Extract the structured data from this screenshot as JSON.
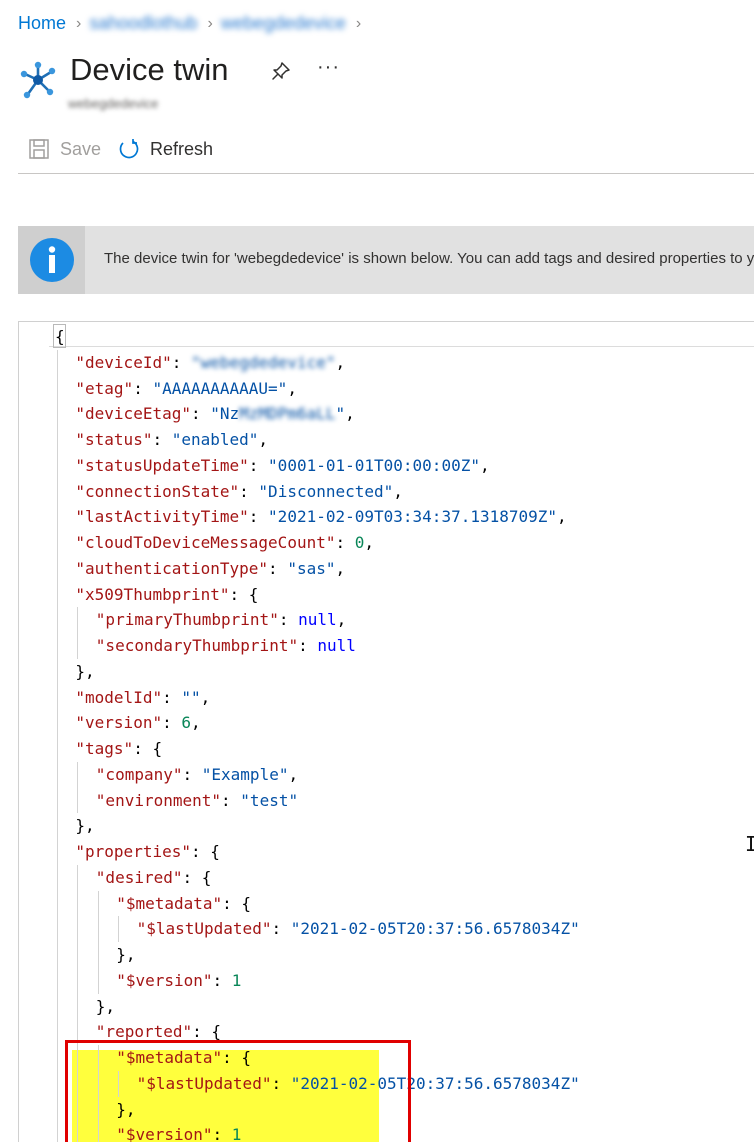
{
  "breadcrumb": {
    "home": "Home",
    "hub": "sahoodlothub",
    "device": "webegdedevice"
  },
  "header": {
    "title": "Device twin",
    "subtitle": "webegdedevice",
    "icons": {
      "service": "iot-hub-icon",
      "pin": "pin-icon",
      "more": "more-icon"
    },
    "more_label": "···"
  },
  "toolbar": {
    "save_label": "Save",
    "refresh_label": "Refresh"
  },
  "info_banner": {
    "text": "The device twin for 'webegdedevice' is shown below. You can add tags and desired properties to your device twin here."
  },
  "editor": {
    "lines": [
      [
        [
          "p",
          "{"
        ]
      ],
      [
        [
          "k",
          "\"deviceId\""
        ],
        [
          "p",
          ": "
        ],
        [
          "x",
          "\"webegdedevice\""
        ],
        [
          "p",
          ","
        ]
      ],
      [
        [
          "k",
          "\"etag\""
        ],
        [
          "p",
          ": "
        ],
        [
          "s",
          "\"AAAAAAAAAAU=\""
        ],
        [
          "p",
          ","
        ]
      ],
      [
        [
          "k",
          "\"deviceEtag\""
        ],
        [
          "p",
          ": "
        ],
        [
          "s",
          "\"Nz"
        ],
        [
          "x",
          "MzMDPm6aLL"
        ],
        [
          "s",
          "\""
        ],
        [
          "p",
          ","
        ]
      ],
      [
        [
          "k",
          "\"status\""
        ],
        [
          "p",
          ": "
        ],
        [
          "s",
          "\"enabled\""
        ],
        [
          "p",
          ","
        ]
      ],
      [
        [
          "k",
          "\"statusUpdateTime\""
        ],
        [
          "p",
          ": "
        ],
        [
          "s",
          "\"0001-01-01T00:00:00Z\""
        ],
        [
          "p",
          ","
        ]
      ],
      [
        [
          "k",
          "\"connectionState\""
        ],
        [
          "p",
          ": "
        ],
        [
          "s",
          "\"Disconnected\""
        ],
        [
          "p",
          ","
        ]
      ],
      [
        [
          "k",
          "\"lastActivityTime\""
        ],
        [
          "p",
          ": "
        ],
        [
          "s",
          "\"2021-02-09T03:34:37.1318709Z\""
        ],
        [
          "p",
          ","
        ]
      ],
      [
        [
          "k",
          "\"cloudToDeviceMessageCount\""
        ],
        [
          "p",
          ": "
        ],
        [
          "n",
          "0"
        ],
        [
          "p",
          ","
        ]
      ],
      [
        [
          "k",
          "\"authenticationType\""
        ],
        [
          "p",
          ": "
        ],
        [
          "s",
          "\"sas\""
        ],
        [
          "p",
          ","
        ]
      ],
      [
        [
          "k",
          "\"x509Thumbprint\""
        ],
        [
          "p",
          ": {"
        ]
      ],
      [
        [
          "k",
          "\"primaryThumbprint\""
        ],
        [
          "p",
          ": "
        ],
        [
          "b",
          "null"
        ],
        [
          "p",
          ","
        ]
      ],
      [
        [
          "k",
          "\"secondaryThumbprint\""
        ],
        [
          "p",
          ": "
        ],
        [
          "b",
          "null"
        ]
      ],
      [
        [
          "p",
          "},"
        ]
      ],
      [
        [
          "k",
          "\"modelId\""
        ],
        [
          "p",
          ": "
        ],
        [
          "s",
          "\"\""
        ],
        [
          "p",
          ","
        ]
      ],
      [
        [
          "k",
          "\"version\""
        ],
        [
          "p",
          ": "
        ],
        [
          "n",
          "6"
        ],
        [
          "p",
          ","
        ]
      ],
      [
        [
          "k",
          "\"tags\""
        ],
        [
          "p",
          ": {"
        ]
      ],
      [
        [
          "k",
          "\"company\""
        ],
        [
          "p",
          ": "
        ],
        [
          "s",
          "\"Example\""
        ],
        [
          "p",
          ","
        ]
      ],
      [
        [
          "k",
          "\"environment\""
        ],
        [
          "p",
          ": "
        ],
        [
          "s",
          "\"test\""
        ]
      ],
      [
        [
          "p",
          "},"
        ]
      ],
      [
        [
          "k",
          "\"properties\""
        ],
        [
          "p",
          ": {"
        ]
      ],
      [
        [
          "k",
          "\"desired\""
        ],
        [
          "p",
          ": {"
        ]
      ],
      [
        [
          "k",
          "\"$metadata\""
        ],
        [
          "p",
          ": {"
        ]
      ],
      [
        [
          "k",
          "\"$lastUpdated\""
        ],
        [
          "p",
          ": "
        ],
        [
          "s",
          "\"2021-02-05T20:37:56.6578034Z\""
        ]
      ],
      [
        [
          "p",
          "},"
        ]
      ],
      [
        [
          "k",
          "\"$version\""
        ],
        [
          "p",
          ": "
        ],
        [
          "n",
          "1"
        ]
      ],
      [
        [
          "p",
          "},"
        ]
      ],
      [
        [
          "k",
          "\"reported\""
        ],
        [
          "p",
          ": {"
        ]
      ],
      [
        [
          "k",
          "\"$metadata\""
        ],
        [
          "p",
          ": {"
        ]
      ],
      [
        [
          "k",
          "\"$lastUpdated\""
        ],
        [
          "p",
          ": "
        ],
        [
          "s",
          "\"2021-02-05T20:37:56.6578034Z\""
        ]
      ],
      [
        [
          "p",
          "},"
        ]
      ],
      [
        [
          "k",
          "\"$version\""
        ],
        [
          "p",
          ": "
        ],
        [
          "n",
          "1"
        ]
      ]
    ],
    "indents": [
      0,
      1,
      1,
      1,
      1,
      1,
      1,
      1,
      1,
      1,
      1,
      2,
      2,
      1,
      1,
      1,
      1,
      2,
      2,
      1,
      1,
      2,
      3,
      4,
      3,
      3,
      2,
      2,
      3,
      4,
      3,
      3
    ],
    "highlight_colors": {
      "tags": "#ffff3d",
      "outline": "#e00000"
    }
  }
}
